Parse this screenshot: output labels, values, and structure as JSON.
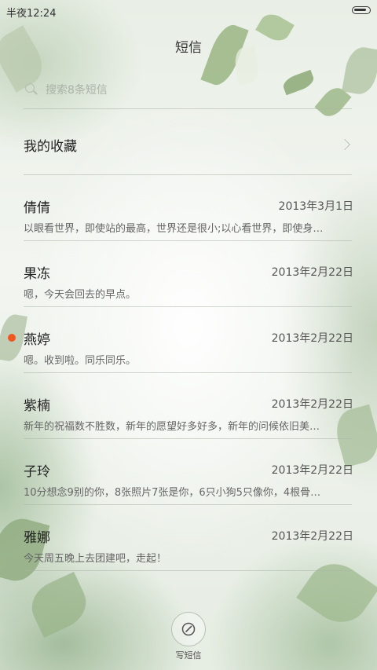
{
  "status_bar": {
    "time": "半夜12:24"
  },
  "header": {
    "title": "短信"
  },
  "search": {
    "placeholder": "搜索8条短信"
  },
  "favorites": {
    "label": "我的收藏"
  },
  "messages": [
    {
      "name": "倩倩",
      "date": "2013年3月1日",
      "preview": "以眼看世界，即使站的最高，世界还是很小;以心看世界，即使身…",
      "unread": false
    },
    {
      "name": "果冻",
      "date": "2013年2月22日",
      "preview": "嗯，今天会回去的早点。",
      "unread": false
    },
    {
      "name": "燕婷",
      "date": "2013年2月22日",
      "preview": "嗯。收到啦。同乐同乐。",
      "unread": true
    },
    {
      "name": "紫楠",
      "date": "2013年2月22日",
      "preview": "新年的祝福数不胜数，新年的愿望好多好多，新年的问候依旧美…",
      "unread": false
    },
    {
      "name": "子玲",
      "date": "2013年2月22日",
      "preview": "10分想念9别的你，8张照片7张是你，6只小狗5只像你，4根骨…",
      "unread": false
    },
    {
      "name": "雅娜",
      "date": "2013年2月22日",
      "preview": "今天周五晚上去团建吧，走起！",
      "unread": false
    }
  ],
  "compose": {
    "label": "写短信",
    "icon": "compose-icon"
  },
  "colors": {
    "unread": "#f0571f",
    "text_primary": "#222222",
    "text_secondary": "#666666"
  }
}
